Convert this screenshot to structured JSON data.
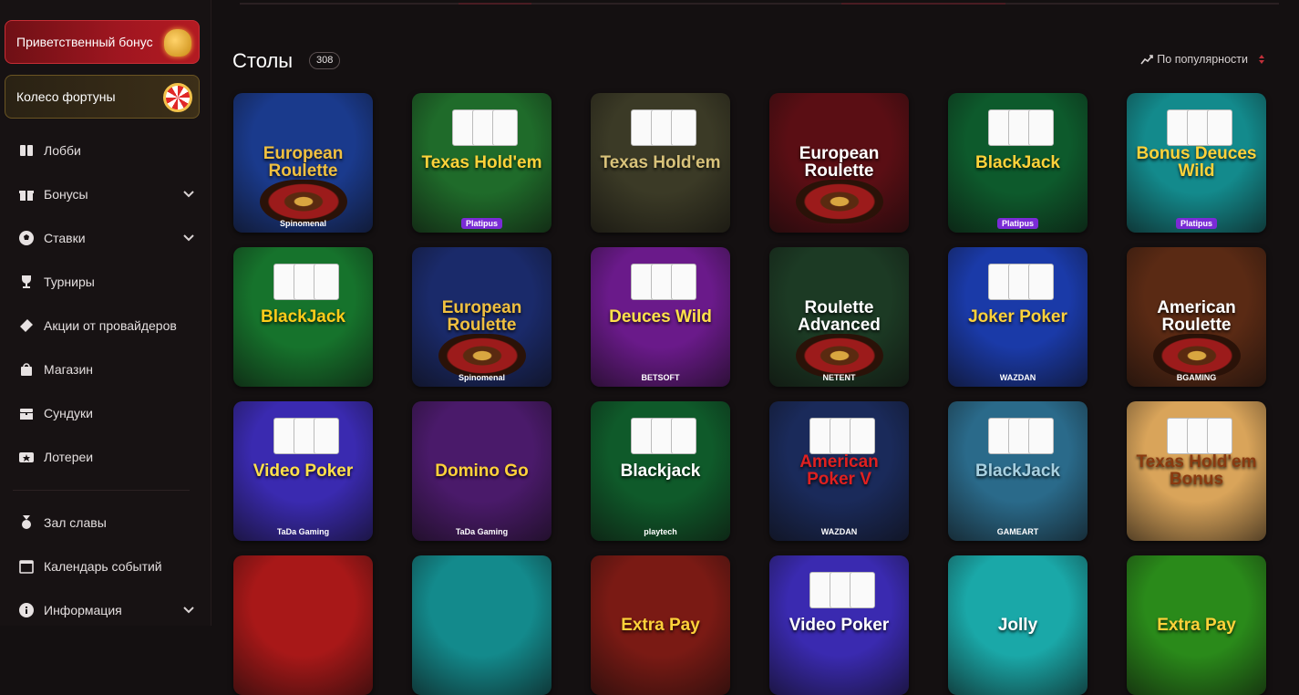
{
  "sidebar": {
    "promo_bonus": "Приветственный бонус",
    "promo_wheel": "Колесо фортуны",
    "items": [
      {
        "label": "Лобби",
        "icon": "lobby-icon"
      },
      {
        "label": "Бонусы",
        "icon": "gift-icon",
        "expandable": true
      },
      {
        "label": "Ставки",
        "icon": "ball-icon",
        "expandable": true
      },
      {
        "label": "Турниры",
        "icon": "trophy-icon"
      },
      {
        "label": "Акции от провайдеров",
        "icon": "ticket-icon"
      },
      {
        "label": "Магазин",
        "icon": "bag-icon"
      },
      {
        "label": "Сундуки",
        "icon": "chest-icon"
      },
      {
        "label": "Лотереи",
        "icon": "lottery-icon"
      },
      {
        "label": "Зал славы",
        "icon": "medal-icon"
      },
      {
        "label": "Календарь событий",
        "icon": "calendar-icon"
      },
      {
        "label": "Информация",
        "icon": "info-icon",
        "expandable": true
      }
    ]
  },
  "main": {
    "title": "Столы",
    "count": "308",
    "sort_label": "По популярности"
  },
  "games": [
    {
      "name": "European Roulette",
      "provider": "Spinomenal",
      "bg": "#1a3a8c",
      "accent": "#f0c040",
      "badge": false
    },
    {
      "name": "Texas Hold'em",
      "provider": "Platipus",
      "bg": "#1f6b2a",
      "accent": "#ffd23a",
      "badge": true
    },
    {
      "name": "Texas Hold'em",
      "provider": "",
      "bg": "#3b3a26",
      "accent": "#d8c27a",
      "badge": false
    },
    {
      "name": "European Roulette",
      "provider": "",
      "bg": "#5a0e14",
      "accent": "#ffffff",
      "badge": false
    },
    {
      "name": "BlackJack",
      "provider": "Platipus",
      "bg": "#0d5a2c",
      "accent": "#ffd23a",
      "badge": true
    },
    {
      "name": "Bonus Deuces Wild",
      "provider": "Platipus",
      "bg": "#138a8c",
      "accent": "#ffd23a",
      "badge": true
    },
    {
      "name": "BlackJack",
      "provider": "",
      "bg": "#16732c",
      "accent": "#ffcc1a",
      "badge": false
    },
    {
      "name": "European Roulette",
      "provider": "Spinomenal",
      "bg": "#1a2a6a",
      "accent": "#f0c040",
      "badge": false
    },
    {
      "name": "Deuces Wild",
      "provider": "BETSOFT",
      "bg": "#6a1a8a",
      "accent": "#ffe14a",
      "badge": false
    },
    {
      "name": "Roulette Advanced",
      "provider": "NETENT",
      "bg": "#1c3a24",
      "accent": "#ffffff",
      "badge": false
    },
    {
      "name": "Joker Poker",
      "provider": "WAZDAN",
      "bg": "#1a3aa8",
      "accent": "#ffd23a",
      "badge": false
    },
    {
      "name": "American Roulette",
      "provider": "BGAMING",
      "bg": "#5a2a14",
      "accent": "#ffffff",
      "badge": false
    },
    {
      "name": "Video Poker",
      "provider": "TaDa Gaming",
      "bg": "#3a2ab0",
      "accent": "#ffe14a",
      "badge": false
    },
    {
      "name": "Domino Go",
      "provider": "TaDa Gaming",
      "bg": "#4a1a6a",
      "accent": "#ffd23a",
      "badge": false
    },
    {
      "name": "Blackjack",
      "provider": "playtech",
      "bg": "#0f5a2a",
      "accent": "#ffffff",
      "badge": false
    },
    {
      "name": "American Poker V",
      "provider": "WAZDAN",
      "bg": "#1a2a5a",
      "accent": "#e02020",
      "badge": false
    },
    {
      "name": "BlackJack",
      "provider": "GAMEART",
      "bg": "#2a6a8a",
      "accent": "#a8d0e0",
      "badge": false
    },
    {
      "name": "Texas Hold'em Bonus",
      "provider": "",
      "bg": "#d9a45a",
      "accent": "#8a3a10",
      "badge": false
    },
    {
      "name": "",
      "provider": "",
      "bg": "#a81818",
      "accent": "#ffd23a",
      "badge": false
    },
    {
      "name": "",
      "provider": "",
      "bg": "#138a8c",
      "accent": "#ffd23a",
      "badge": false
    },
    {
      "name": "Extra Pay",
      "provider": "",
      "bg": "#7a1a14",
      "accent": "#ffd23a",
      "badge": false
    },
    {
      "name": "Video Poker",
      "provider": "",
      "bg": "#3a2ab0",
      "accent": "#ffffff",
      "badge": false
    },
    {
      "name": "Jolly",
      "provider": "",
      "bg": "#1aa8a8",
      "accent": "#ffffff",
      "badge": false
    },
    {
      "name": "Extra Pay",
      "provider": "",
      "bg": "#2a8a1a",
      "accent": "#ffd23a",
      "badge": false
    }
  ]
}
